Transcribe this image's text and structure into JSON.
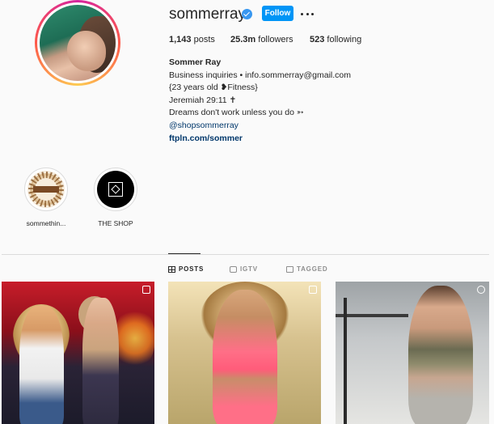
{
  "profile": {
    "username": "sommerray",
    "follow_label": "Follow",
    "stats": {
      "posts_count": "1,143",
      "posts_label": " posts",
      "followers_count": "25.3m",
      "followers_label": " followers",
      "following_count": "523",
      "following_label": " following"
    },
    "bio": {
      "name": "Sommer Ray",
      "lines": [
        "Business inquiries • info.sommerray@gmail.com",
        "{23 years old ❥Fitness}",
        "Jeremiah 29:11 ✝",
        "Dreams don't work unless you do ➳"
      ],
      "tag": "@shopsommerray",
      "link": "ftpln.com/sommer"
    }
  },
  "highlights": [
    {
      "label": "sommethin...",
      "icon": "sun-logo-icon"
    },
    {
      "label": "THE SHOP",
      "icon": "shop-logo-icon"
    }
  ],
  "tabs": [
    {
      "label": "POSTS",
      "icon": "grid-icon",
      "active": true
    },
    {
      "label": "IGTV",
      "icon": "igtv-icon",
      "active": false
    },
    {
      "label": "TAGGED",
      "icon": "tag-icon",
      "active": false
    }
  ],
  "posts": [
    {
      "badge": "multiple-photos-icon"
    },
    {
      "badge": "multiple-photos-icon"
    },
    {
      "badge": "reel-icon"
    }
  ],
  "colors": {
    "accent": "#0095f6",
    "verified": "#3897f0",
    "link": "#00376b"
  }
}
